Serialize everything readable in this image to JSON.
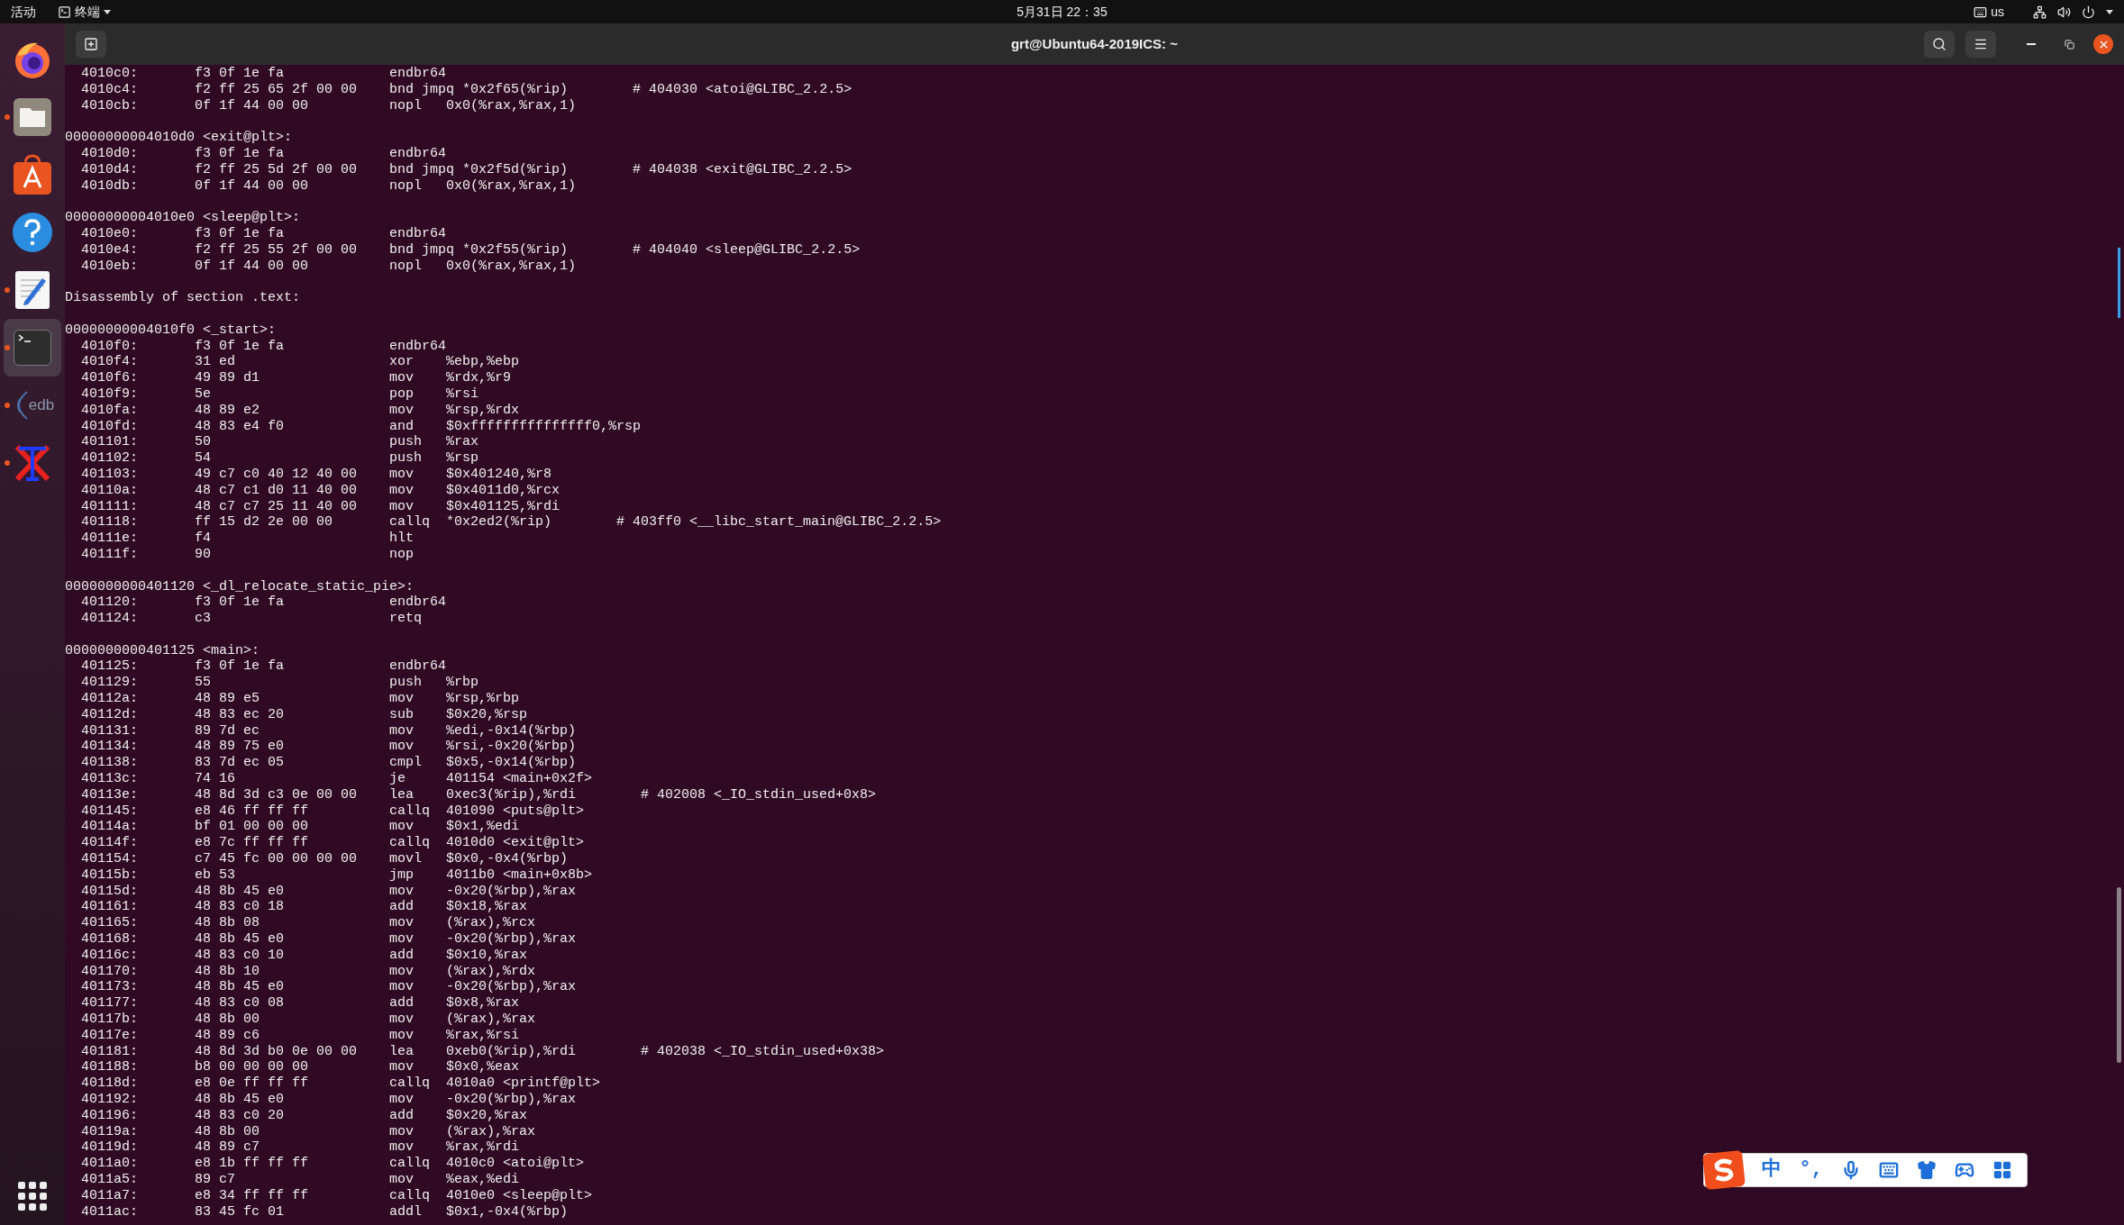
{
  "top_bar": {
    "activities": "活动",
    "app_menu": "终端",
    "clock": "5月31日 22：35",
    "keyboard_layout": "us"
  },
  "dock": {
    "items": [
      {
        "kind": "firefox",
        "running": false,
        "selected": false
      },
      {
        "kind": "files",
        "running": true,
        "selected": false
      },
      {
        "kind": "software",
        "running": false,
        "selected": false
      },
      {
        "kind": "help",
        "running": false,
        "selected": false
      },
      {
        "kind": "editor",
        "running": true,
        "selected": false
      },
      {
        "kind": "terminal",
        "running": true,
        "selected": true
      },
      {
        "kind": "edb",
        "label": "edb",
        "running": true,
        "selected": false
      },
      {
        "kind": "xlogo",
        "running": true,
        "selected": false
      }
    ]
  },
  "window": {
    "title": "grt@Ubuntu64-2019ICS: ~"
  },
  "terminal": {
    "lines": [
      {
        "kind": "insn",
        "address": "4010c0:",
        "bytes": "f3 0f 1e fa",
        "mnemonic": "endbr64"
      },
      {
        "kind": "insn",
        "address": "4010c4:",
        "bytes": "f2 ff 25 65 2f 00 00",
        "mnemonic": "bnd jmpq",
        "operands": "*0x2f65(%rip)",
        "comment": "# 404030 <atoi@GLIBC_2.2.5>"
      },
      {
        "kind": "insn",
        "address": "4010cb:",
        "bytes": "0f 1f 44 00 00",
        "mnemonic": "nopl",
        "operands": "0x0(%rax,%rax,1)"
      },
      {
        "kind": "blank"
      },
      {
        "kind": "header",
        "text": "00000000004010d0 <exit@plt>:"
      },
      {
        "kind": "insn",
        "address": "4010d0:",
        "bytes": "f3 0f 1e fa",
        "mnemonic": "endbr64"
      },
      {
        "kind": "insn",
        "address": "4010d4:",
        "bytes": "f2 ff 25 5d 2f 00 00",
        "mnemonic": "bnd jmpq",
        "operands": "*0x2f5d(%rip)",
        "comment": "# 404038 <exit@GLIBC_2.2.5>"
      },
      {
        "kind": "insn",
        "address": "4010db:",
        "bytes": "0f 1f 44 00 00",
        "mnemonic": "nopl",
        "operands": "0x0(%rax,%rax,1)"
      },
      {
        "kind": "blank"
      },
      {
        "kind": "header",
        "text": "00000000004010e0 <sleep@plt>:"
      },
      {
        "kind": "insn",
        "address": "4010e0:",
        "bytes": "f3 0f 1e fa",
        "mnemonic": "endbr64"
      },
      {
        "kind": "insn",
        "address": "4010e4:",
        "bytes": "f2 ff 25 55 2f 00 00",
        "mnemonic": "bnd jmpq",
        "operands": "*0x2f55(%rip)",
        "comment": "# 404040 <sleep@GLIBC_2.2.5>"
      },
      {
        "kind": "insn",
        "address": "4010eb:",
        "bytes": "0f 1f 44 00 00",
        "mnemonic": "nopl",
        "operands": "0x0(%rax,%rax,1)"
      },
      {
        "kind": "blank"
      },
      {
        "kind": "section",
        "text": "Disassembly of section .text:"
      },
      {
        "kind": "blank"
      },
      {
        "kind": "header",
        "text": "00000000004010f0 <_start>:"
      },
      {
        "kind": "insn",
        "address": "4010f0:",
        "bytes": "f3 0f 1e fa",
        "mnemonic": "endbr64"
      },
      {
        "kind": "insn",
        "address": "4010f4:",
        "bytes": "31 ed",
        "mnemonic": "xor",
        "operands": "%ebp,%ebp"
      },
      {
        "kind": "insn",
        "address": "4010f6:",
        "bytes": "49 89 d1",
        "mnemonic": "mov",
        "operands": "%rdx,%r9"
      },
      {
        "kind": "insn",
        "address": "4010f9:",
        "bytes": "5e",
        "mnemonic": "pop",
        "operands": "%rsi"
      },
      {
        "kind": "insn",
        "address": "4010fa:",
        "bytes": "48 89 e2",
        "mnemonic": "mov",
        "operands": "%rsp,%rdx"
      },
      {
        "kind": "insn",
        "address": "4010fd:",
        "bytes": "48 83 e4 f0",
        "mnemonic": "and",
        "operands": "$0xfffffffffffffff0,%rsp"
      },
      {
        "kind": "insn",
        "address": "401101:",
        "bytes": "50",
        "mnemonic": "push",
        "operands": "%rax"
      },
      {
        "kind": "insn",
        "address": "401102:",
        "bytes": "54",
        "mnemonic": "push",
        "operands": "%rsp"
      },
      {
        "kind": "insn",
        "address": "401103:",
        "bytes": "49 c7 c0 40 12 40 00",
        "mnemonic": "mov",
        "operands": "$0x401240,%r8"
      },
      {
        "kind": "insn",
        "address": "40110a:",
        "bytes": "48 c7 c1 d0 11 40 00",
        "mnemonic": "mov",
        "operands": "$0x4011d0,%rcx"
      },
      {
        "kind": "insn",
        "address": "401111:",
        "bytes": "48 c7 c7 25 11 40 00",
        "mnemonic": "mov",
        "operands": "$0x401125,%rdi"
      },
      {
        "kind": "insn",
        "address": "401118:",
        "bytes": "ff 15 d2 2e 00 00",
        "mnemonic": "callq",
        "operands": "*0x2ed2(%rip)",
        "comment": "# 403ff0 <__libc_start_main@GLIBC_2.2.5>"
      },
      {
        "kind": "insn",
        "address": "40111e:",
        "bytes": "f4",
        "mnemonic": "hlt"
      },
      {
        "kind": "insn",
        "address": "40111f:",
        "bytes": "90",
        "mnemonic": "nop"
      },
      {
        "kind": "blank"
      },
      {
        "kind": "header",
        "text": "0000000000401120 <_dl_relocate_static_pie>:"
      },
      {
        "kind": "insn",
        "address": "401120:",
        "bytes": "f3 0f 1e fa",
        "mnemonic": "endbr64"
      },
      {
        "kind": "insn",
        "address": "401124:",
        "bytes": "c3",
        "mnemonic": "retq"
      },
      {
        "kind": "blank"
      },
      {
        "kind": "header",
        "text": "0000000000401125 <main>:"
      },
      {
        "kind": "insn",
        "address": "401125:",
        "bytes": "f3 0f 1e fa",
        "mnemonic": "endbr64"
      },
      {
        "kind": "insn",
        "address": "401129:",
        "bytes": "55",
        "mnemonic": "push",
        "operands": "%rbp"
      },
      {
        "kind": "insn",
        "address": "40112a:",
        "bytes": "48 89 e5",
        "mnemonic": "mov",
        "operands": "%rsp,%rbp"
      },
      {
        "kind": "insn",
        "address": "40112d:",
        "bytes": "48 83 ec 20",
        "mnemonic": "sub",
        "operands": "$0x20,%rsp"
      },
      {
        "kind": "insn",
        "address": "401131:",
        "bytes": "89 7d ec",
        "mnemonic": "mov",
        "operands": "%edi,-0x14(%rbp)"
      },
      {
        "kind": "insn",
        "address": "401134:",
        "bytes": "48 89 75 e0",
        "mnemonic": "mov",
        "operands": "%rsi,-0x20(%rbp)"
      },
      {
        "kind": "insn",
        "address": "401138:",
        "bytes": "83 7d ec 05",
        "mnemonic": "cmpl",
        "operands": "$0x5,-0x14(%rbp)"
      },
      {
        "kind": "insn",
        "address": "40113c:",
        "bytes": "74 16",
        "mnemonic": "je",
        "operands": "401154 <main+0x2f>"
      },
      {
        "kind": "insn",
        "address": "40113e:",
        "bytes": "48 8d 3d c3 0e 00 00",
        "mnemonic": "lea",
        "operands": "0xec3(%rip),%rdi",
        "comment": "# 402008 <_IO_stdin_used+0x8>"
      },
      {
        "kind": "insn",
        "address": "401145:",
        "bytes": "e8 46 ff ff ff",
        "mnemonic": "callq",
        "operands": "401090 <puts@plt>"
      },
      {
        "kind": "insn",
        "address": "40114a:",
        "bytes": "bf 01 00 00 00",
        "mnemonic": "mov",
        "operands": "$0x1,%edi"
      },
      {
        "kind": "insn",
        "address": "40114f:",
        "bytes": "e8 7c ff ff ff",
        "mnemonic": "callq",
        "operands": "4010d0 <exit@plt>"
      },
      {
        "kind": "insn",
        "address": "401154:",
        "bytes": "c7 45 fc 00 00 00 00",
        "mnemonic": "movl",
        "operands": "$0x0,-0x4(%rbp)"
      },
      {
        "kind": "insn",
        "address": "40115b:",
        "bytes": "eb 53",
        "mnemonic": "jmp",
        "operands": "4011b0 <main+0x8b>"
      },
      {
        "kind": "insn",
        "address": "40115d:",
        "bytes": "48 8b 45 e0",
        "mnemonic": "mov",
        "operands": "-0x20(%rbp),%rax"
      },
      {
        "kind": "insn",
        "address": "401161:",
        "bytes": "48 83 c0 18",
        "mnemonic": "add",
        "operands": "$0x18,%rax"
      },
      {
        "kind": "insn",
        "address": "401165:",
        "bytes": "48 8b 08",
        "mnemonic": "mov",
        "operands": "(%rax),%rcx"
      },
      {
        "kind": "insn",
        "address": "401168:",
        "bytes": "48 8b 45 e0",
        "mnemonic": "mov",
        "operands": "-0x20(%rbp),%rax"
      },
      {
        "kind": "insn",
        "address": "40116c:",
        "bytes": "48 83 c0 10",
        "mnemonic": "add",
        "operands": "$0x10,%rax"
      },
      {
        "kind": "insn",
        "address": "401170:",
        "bytes": "48 8b 10",
        "mnemonic": "mov",
        "operands": "(%rax),%rdx"
      },
      {
        "kind": "insn",
        "address": "401173:",
        "bytes": "48 8b 45 e0",
        "mnemonic": "mov",
        "operands": "-0x20(%rbp),%rax"
      },
      {
        "kind": "insn",
        "address": "401177:",
        "bytes": "48 83 c0 08",
        "mnemonic": "add",
        "operands": "$0x8,%rax"
      },
      {
        "kind": "insn",
        "address": "40117b:",
        "bytes": "48 8b 00",
        "mnemonic": "mov",
        "operands": "(%rax),%rax"
      },
      {
        "kind": "insn",
        "address": "40117e:",
        "bytes": "48 89 c6",
        "mnemonic": "mov",
        "operands": "%rax,%rsi"
      },
      {
        "kind": "insn",
        "address": "401181:",
        "bytes": "48 8d 3d b0 0e 00 00",
        "mnemonic": "lea",
        "operands": "0xeb0(%rip),%rdi",
        "comment": "# 402038 <_IO_stdin_used+0x38>"
      },
      {
        "kind": "insn",
        "address": "401188:",
        "bytes": "b8 00 00 00 00",
        "mnemonic": "mov",
        "operands": "$0x0,%eax"
      },
      {
        "kind": "insn",
        "address": "40118d:",
        "bytes": "e8 0e ff ff ff",
        "mnemonic": "callq",
        "operands": "4010a0 <printf@plt>"
      },
      {
        "kind": "insn",
        "address": "401192:",
        "bytes": "48 8b 45 e0",
        "mnemonic": "mov",
        "operands": "-0x20(%rbp),%rax"
      },
      {
        "kind": "insn",
        "address": "401196:",
        "bytes": "48 83 c0 20",
        "mnemonic": "add",
        "operands": "$0x20,%rax"
      },
      {
        "kind": "insn",
        "address": "40119a:",
        "bytes": "48 8b 00",
        "mnemonic": "mov",
        "operands": "(%rax),%rax"
      },
      {
        "kind": "insn",
        "address": "40119d:",
        "bytes": "48 89 c7",
        "mnemonic": "mov",
        "operands": "%rax,%rdi"
      },
      {
        "kind": "insn",
        "address": "4011a0:",
        "bytes": "e8 1b ff ff ff",
        "mnemonic": "callq",
        "operands": "4010c0 <atoi@plt>"
      },
      {
        "kind": "insn",
        "address": "4011a5:",
        "bytes": "89 c7",
        "mnemonic": "mov",
        "operands": "%eax,%edi"
      },
      {
        "kind": "insn",
        "address": "4011a7:",
        "bytes": "e8 34 ff ff ff",
        "mnemonic": "callq",
        "operands": "4010e0 <sleep@plt>"
      },
      {
        "kind": "insn",
        "address": "4011ac:",
        "bytes": "83 45 fc 01",
        "mnemonic": "addl",
        "operands": "$0x1,-0x4(%rbp)"
      }
    ]
  },
  "ime_toolbar": {
    "items": [
      {
        "kind": "logo"
      },
      {
        "kind": "text",
        "text": "中"
      },
      {
        "kind": "text",
        "text": "°,"
      },
      {
        "kind": "mic"
      },
      {
        "kind": "keyboard"
      },
      {
        "kind": "shirt"
      },
      {
        "kind": "gamepad"
      },
      {
        "kind": "grid"
      }
    ]
  }
}
